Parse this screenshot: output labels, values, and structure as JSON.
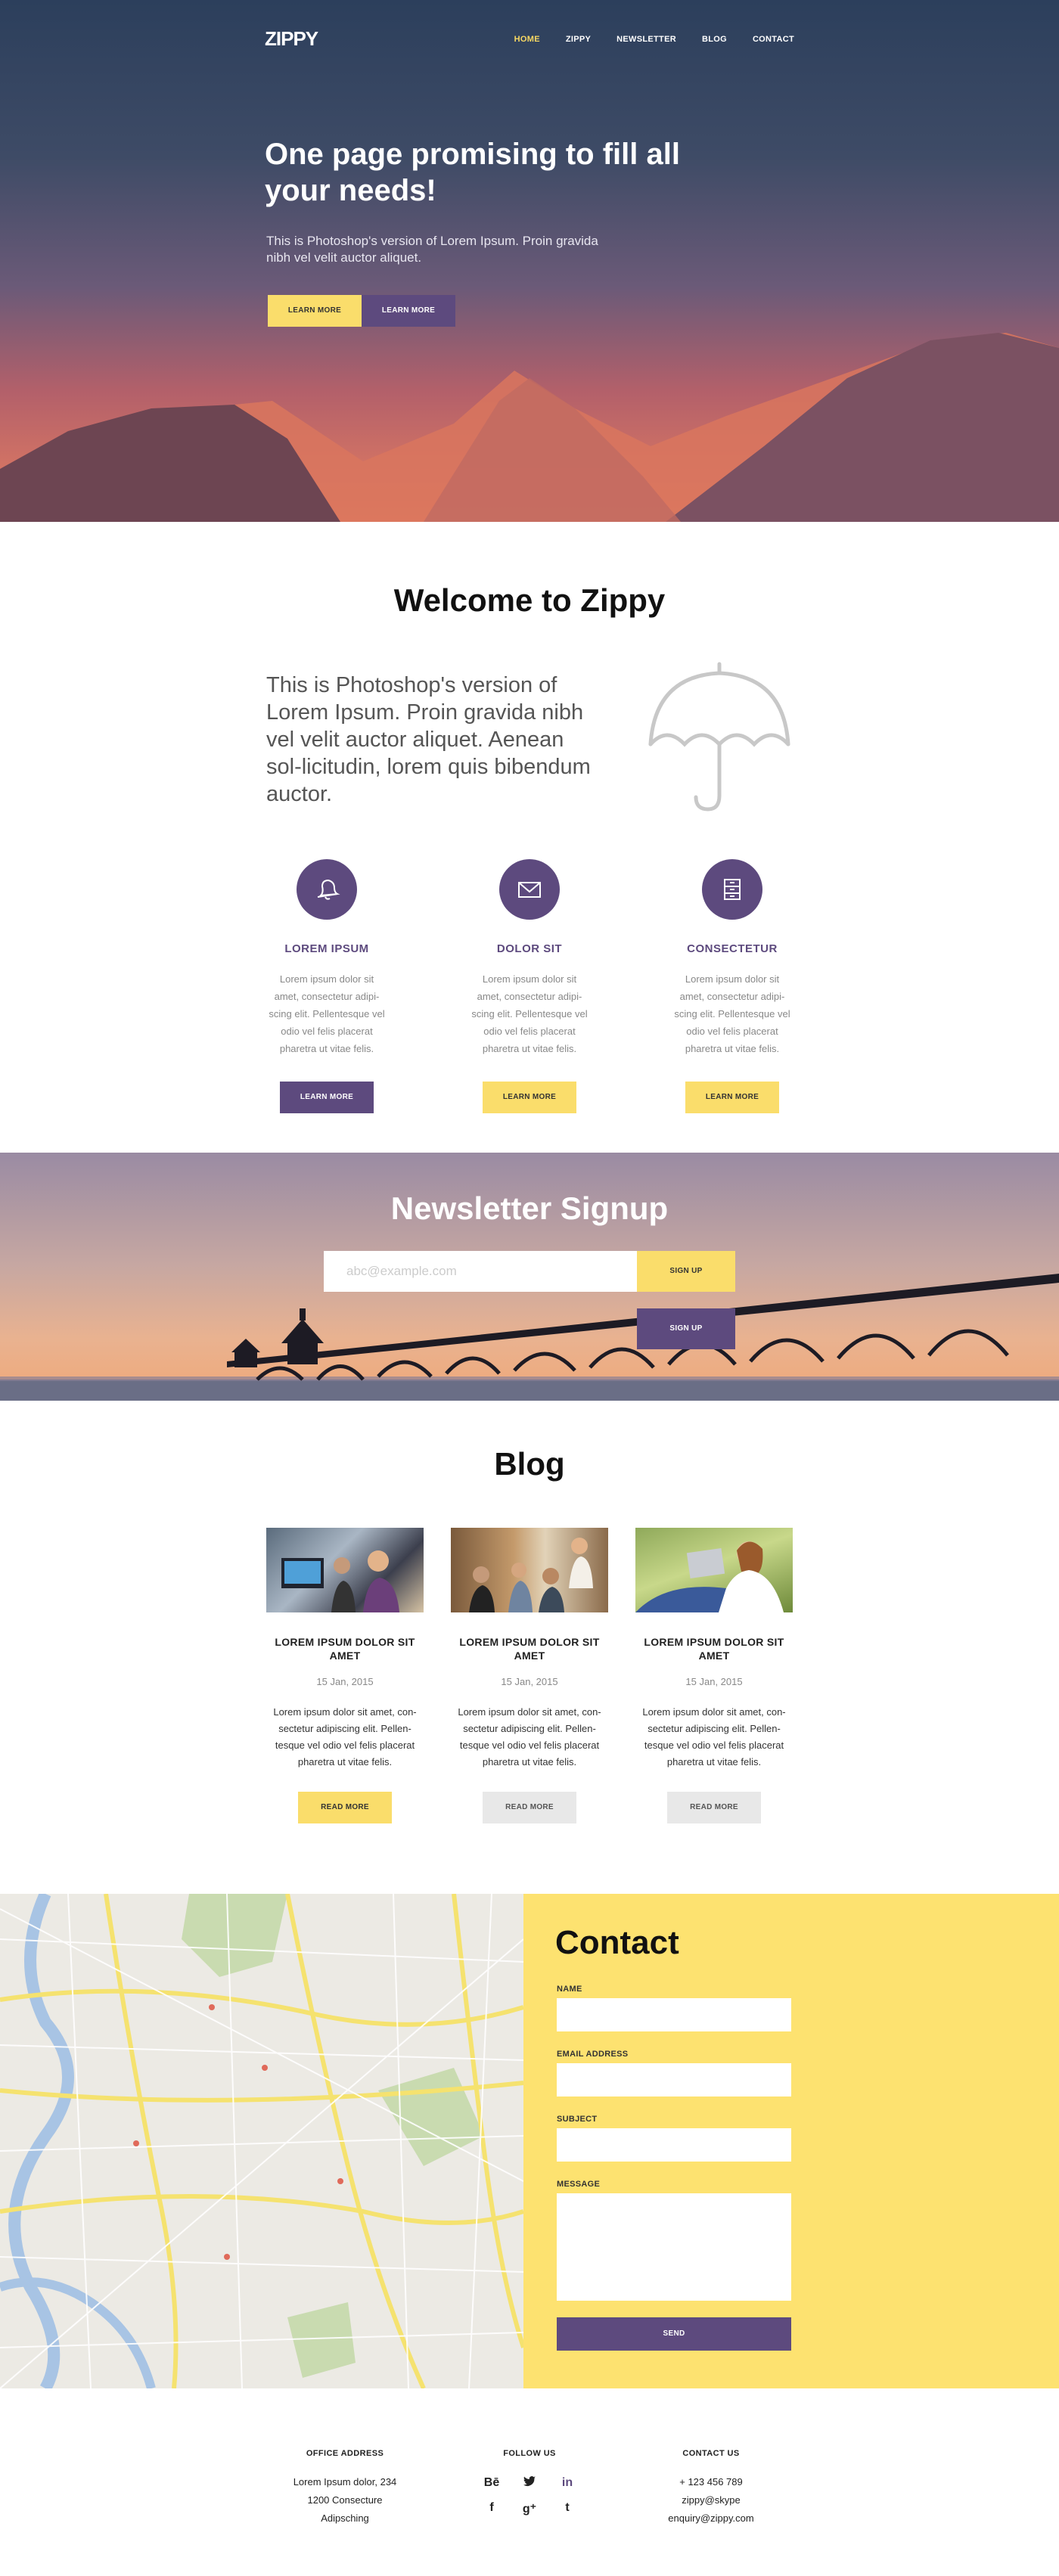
{
  "nav": {
    "logo": "ZIPPY",
    "items": [
      "HOME",
      "ZIPPY",
      "NEWSLETTER",
      "BLOG",
      "CONTACT"
    ],
    "active": "HOME"
  },
  "hero": {
    "title": "One page promising to fill all your needs!",
    "subtitle": "This is Photoshop's version  of Lorem Ipsum. Proin gravida nibh vel velit auctor aliquet.",
    "btn1": "LEARN MORE",
    "btn2": "LEARN MORE"
  },
  "welcome": {
    "title": "Welcome to Zippy",
    "intro": "This is Photoshop's version  of Lorem Ipsum. Proin gravida nibh vel velit auctor aliquet. Aenean sol-licitudin, lorem quis bibendum auctor.",
    "features": [
      {
        "icon": "bell-icon",
        "title": "LOREM IPSUM",
        "text": "Lorem ipsum dolor sit amet, consectetur adipi-scing elit. Pellentesque vel odio vel felis placerat pharetra ut vitae felis.",
        "button": "LEARN MORE"
      },
      {
        "icon": "envelope-icon",
        "title": "DOLOR SIT",
        "text": "Lorem ipsum dolor sit amet, consectetur adipi-scing elit. Pellentesque vel odio vel felis placerat pharetra ut vitae felis.",
        "button": "LEARN MORE"
      },
      {
        "icon": "cabinet-icon",
        "title": "CONSECTETUR",
        "text": "Lorem ipsum dolor sit amet, consectetur adipi-scing elit. Pellentesque vel odio vel felis placerat pharetra ut vitae felis.",
        "button": "LEARN MORE"
      }
    ]
  },
  "newsletter": {
    "title": "Newsletter Signup",
    "placeholder": "abc@example.com",
    "btn1": "SIGN UP",
    "btn2": "SIGN UP"
  },
  "blog": {
    "title": "Blog",
    "posts": [
      {
        "title": "LOREM IPSUM DOLOR SIT AMET",
        "date": "15 Jan, 2015",
        "text": "Lorem ipsum dolor sit amet, con-sectetur adipiscing elit. Pellen-tesque vel odio vel felis placerat pharetra ut vitae felis.",
        "button": "READ MORE"
      },
      {
        "title": "LOREM IPSUM DOLOR SIT AMET",
        "date": "15 Jan, 2015",
        "text": "Lorem ipsum dolor sit amet, con-sectetur adipiscing elit. Pellen-tesque vel odio vel felis placerat pharetra ut vitae felis.",
        "button": "READ MORE"
      },
      {
        "title": "LOREM IPSUM DOLOR SIT AMET",
        "date": "15 Jan, 2015",
        "text": "Lorem ipsum dolor sit amet, con-sectetur adipiscing elit. Pellen-tesque vel odio vel felis placerat pharetra ut vitae felis.",
        "button": "READ MORE"
      }
    ]
  },
  "contact": {
    "title": "Contact",
    "name_label": "NAME",
    "email_label": "EMAIL ADDRESS",
    "subject_label": "SUBJECT",
    "message_label": "MESSAGE",
    "send": "SEND"
  },
  "footer": {
    "office_title": "OFFICE ADDRESS",
    "office_lines": [
      "Lorem Ipsum dolor, 234",
      "1200 Consecture",
      "Adipsching"
    ],
    "follow_title": "FOLLOW US",
    "social": [
      {
        "icon": "behance-icon",
        "glyph": "Bē"
      },
      {
        "icon": "twitter-icon",
        "glyph": "🐦"
      },
      {
        "icon": "linkedin-icon",
        "glyph": "in"
      },
      {
        "icon": "facebook-icon",
        "glyph": "f"
      },
      {
        "icon": "googleplus-icon",
        "glyph": "g⁺"
      },
      {
        "icon": "tumblr-icon",
        "glyph": "t"
      }
    ],
    "contact_title": "CONTACT US",
    "contact_lines": [
      "+ 123 456 789",
      "zippy@skype",
      "enquiry@zippy.com"
    ]
  },
  "colors": {
    "purple": "#5d4a7e",
    "yellow": "#fadd6b",
    "contact_bg": "#fde270"
  }
}
